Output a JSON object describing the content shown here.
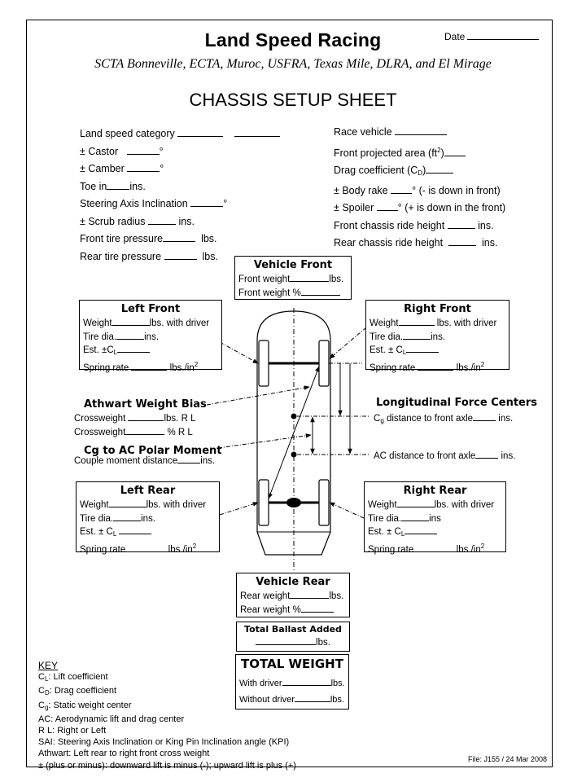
{
  "header": {
    "title": "Land Speed Racing",
    "date_label": "Date",
    "subtitle": "SCTA Bonneville, ECTA, Muroc, USFRA, Texas Mile, DLRA, and El Mirage",
    "sheet_title": "CHASSIS SETUP SHEET"
  },
  "left_fields": [
    {
      "label": "Land speed category",
      "suffix": ""
    },
    {
      "label": "± Castor",
      "suffix": "°"
    },
    {
      "label": "± Camber",
      "suffix": "°"
    },
    {
      "label": "Toe in",
      "suffix": "ins."
    },
    {
      "label": "Steering Axis Inclination",
      "suffix": "°"
    },
    {
      "label": "± Scrub radius",
      "suffix": "ins."
    },
    {
      "label": "Front tire pressure",
      "suffix": "lbs."
    },
    {
      "label": "Rear tire pressure",
      "suffix": "lbs."
    }
  ],
  "right_fields": [
    {
      "label": "Race vehicle",
      "suffix": ""
    },
    {
      "label": "Front projected area (ft",
      "sup": "2",
      "label_end": ")",
      "suffix": ""
    },
    {
      "label": "Drag coefficient (C",
      "sub": "D",
      "label_end": ")",
      "suffix": ""
    },
    {
      "label": "± Body rake",
      "suffix": "° (- is down in front)"
    },
    {
      "label": "± Spoiler",
      "suffix": "° (+ is down in the front)"
    },
    {
      "label": "Front chassis ride height",
      "suffix": "ins."
    },
    {
      "label": "Rear chassis ride height",
      "suffix": "ins."
    }
  ],
  "vehicle_front": {
    "title": "Vehicle Front",
    "rows": [
      "Front weight",
      "lbs.",
      "Front weight %"
    ]
  },
  "left_front": {
    "title": "Left Front",
    "weight": "Weight",
    "weight_suffix": "lbs. with driver",
    "tire": "Tire dia.",
    "tire_suffix": "ins.",
    "est": "Est. ±C",
    "est_sub": "L",
    "spring": "Spring rate",
    "spring_suffix": "lbs./in",
    "spring_sup": "2"
  },
  "right_front": {
    "title": "Right Front",
    "weight": "Weight",
    "weight_suffix": "lbs. with driver",
    "tire": "Tire dia.",
    "tire_suffix": "ins.",
    "est": "Est. ± C",
    "est_sub": "L",
    "spring": "Spring rate",
    "spring_suffix": "lbs./in",
    "spring_sup": "2"
  },
  "left_rear": {
    "title": "Left Rear",
    "weight": "Weight",
    "weight_suffix": "lbs. with driver",
    "tire": "Tire dia.",
    "tire_suffix": "ins.",
    "est": "Est. ± C",
    "est_sub": "L",
    "spring": "Spring rate",
    "spring_suffix": "lbs./in",
    "spring_sup": "2"
  },
  "right_rear": {
    "title": "Right Rear",
    "weight": "Weight",
    "weight_suffix": "lbs. with driver",
    "tire": "Tire dia.",
    "tire_suffix": "ins",
    "est": "Est. ± C",
    "est_sub": "L",
    "spring": "Spring rate",
    "spring_suffix": "lbs./in",
    "spring_sup": "2"
  },
  "athwart": {
    "title": "Athwart Weight Bias",
    "row1_label": "Crossweight",
    "row1_suffix": "lbs. R  L",
    "row2_label": "Crossweight",
    "row2_suffix": "% R  L"
  },
  "polar": {
    "title": "Cg to AC Polar Moment",
    "row_label": "Couple moment distance",
    "row_suffix": "ins."
  },
  "longitudinal": {
    "title": "Longitudinal Force Centers",
    "cg_label": "C",
    "cg_sub": "g",
    "cg_rest": " distance to front axle",
    "cg_suffix": "ins.",
    "ac_label": "AC distance to front axle",
    "ac_suffix": "ins."
  },
  "vehicle_rear": {
    "title": "Vehicle Rear",
    "rear_weight": "Rear weight",
    "rear_weight_suffix": "lbs.",
    "rear_pct": "Rear weight %"
  },
  "ballast": {
    "title": "Total Ballast Added",
    "suffix": "lbs."
  },
  "total_weight": {
    "title": "TOTAL WEIGHT",
    "with_driver": "With driver",
    "with_suffix": "lbs.",
    "without_driver": "Without driver",
    "without_suffix": "lbs."
  },
  "key": {
    "title": "KEY",
    "items": [
      {
        "sym": "C",
        "sub": "L",
        "text": ": Lift coefficient"
      },
      {
        "sym": "C",
        "sub": "D",
        "text": ": Drag coefficient"
      },
      {
        "sym": "C",
        "sub": "g",
        "text": ": Static weight center"
      },
      {
        "sym": "",
        "sub": "",
        "text": "AC: Aerodynamic lift and drag center"
      },
      {
        "sym": "",
        "sub": "",
        "text": "R  L:  Right or Left"
      },
      {
        "sym": "",
        "sub": "",
        "text": "SAI: Steering Axis Inclination or King Pin Inclination angle (KPI)"
      },
      {
        "sym": "",
        "sub": "",
        "text": "Athwart: Left rear to  right front cross weight"
      },
      {
        "sym": "",
        "sub": "",
        "text": "± (plus or minus): downward lift is minus (-); upward lift is plus (+)"
      }
    ]
  },
  "footer": {
    "file": "File: J155 / 24 Mar 2008"
  }
}
